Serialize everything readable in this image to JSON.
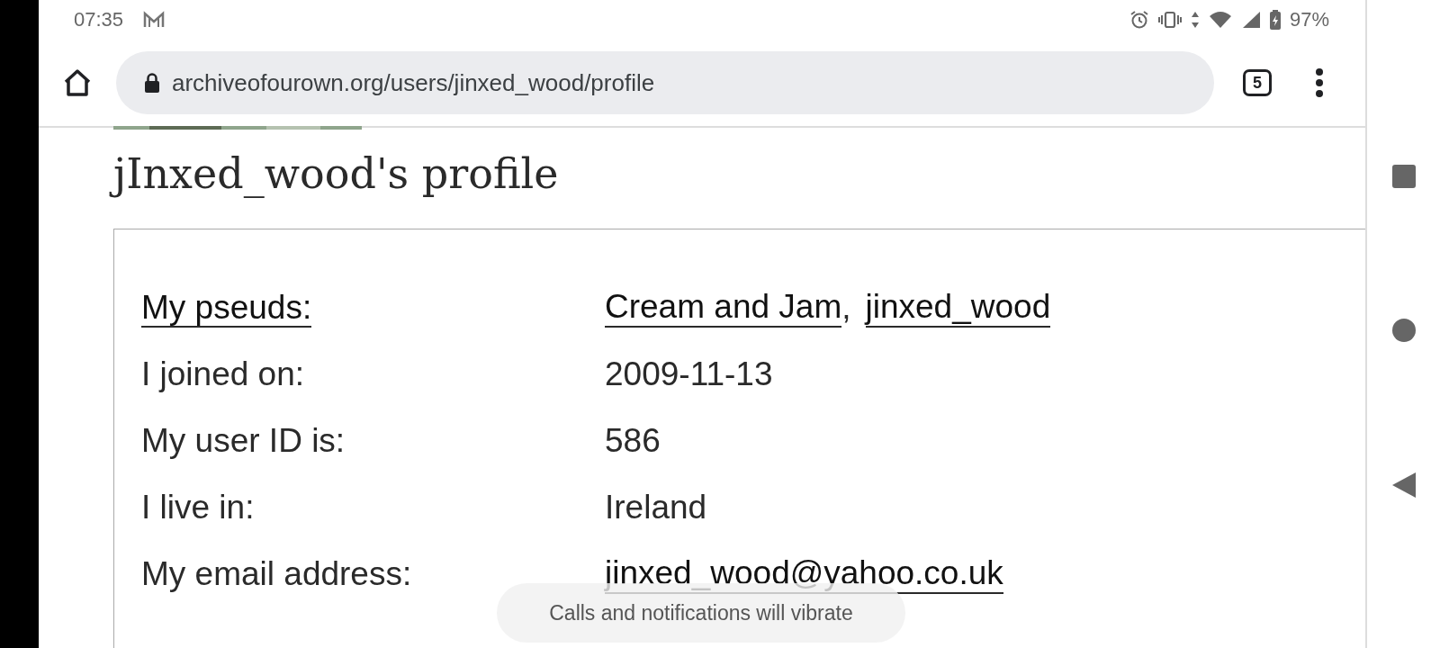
{
  "status_bar": {
    "time": "07:35",
    "battery": "97%"
  },
  "browser": {
    "url": "archiveofourown.org/users/jinxed_wood/profile",
    "tab_count": "5"
  },
  "page": {
    "heading": "jInxed_wood's profile",
    "rows": [
      {
        "label": "My pseuds:",
        "label_link": true,
        "parts": [
          {
            "kind": "link",
            "text": "Cream and Jam"
          },
          {
            "kind": "text",
            "text": ","
          },
          {
            "kind": "link",
            "text": "jinxed_wood"
          }
        ]
      },
      {
        "label": "I joined on:",
        "label_link": false,
        "parts": [
          {
            "kind": "text",
            "text": "2009-11-13"
          }
        ]
      },
      {
        "label": "My user ID is:",
        "label_link": false,
        "parts": [
          {
            "kind": "text",
            "text": "586"
          }
        ]
      },
      {
        "label": "I live in:",
        "label_link": false,
        "parts": [
          {
            "kind": "text",
            "text": "Ireland"
          }
        ]
      },
      {
        "label": "My email address:",
        "label_link": false,
        "parts": [
          {
            "kind": "link",
            "text": "jinxed_wood@yahoo.co.uk"
          }
        ]
      }
    ]
  },
  "toast": {
    "text": "Calls and notifications will vibrate"
  }
}
